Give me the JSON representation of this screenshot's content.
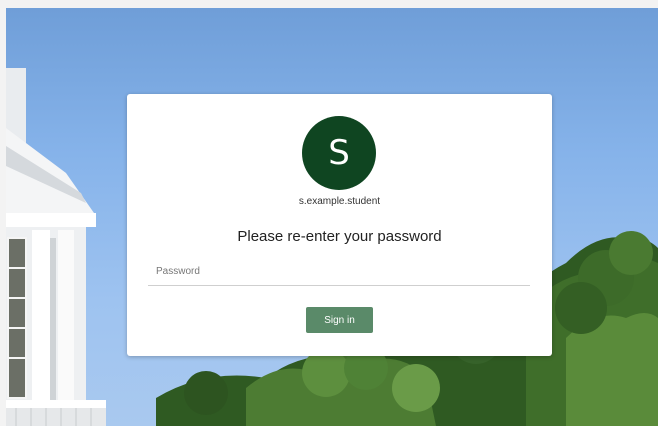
{
  "login": {
    "avatar_initial": "S",
    "username": "s.example.student",
    "heading": "Please re-enter your password",
    "password_placeholder": "Password",
    "password_value": "",
    "signin_label": "Sign in"
  },
  "colors": {
    "avatar_bg": "#0f4521",
    "button_bg": "#5a8a69",
    "sky": "#86b3ea"
  }
}
